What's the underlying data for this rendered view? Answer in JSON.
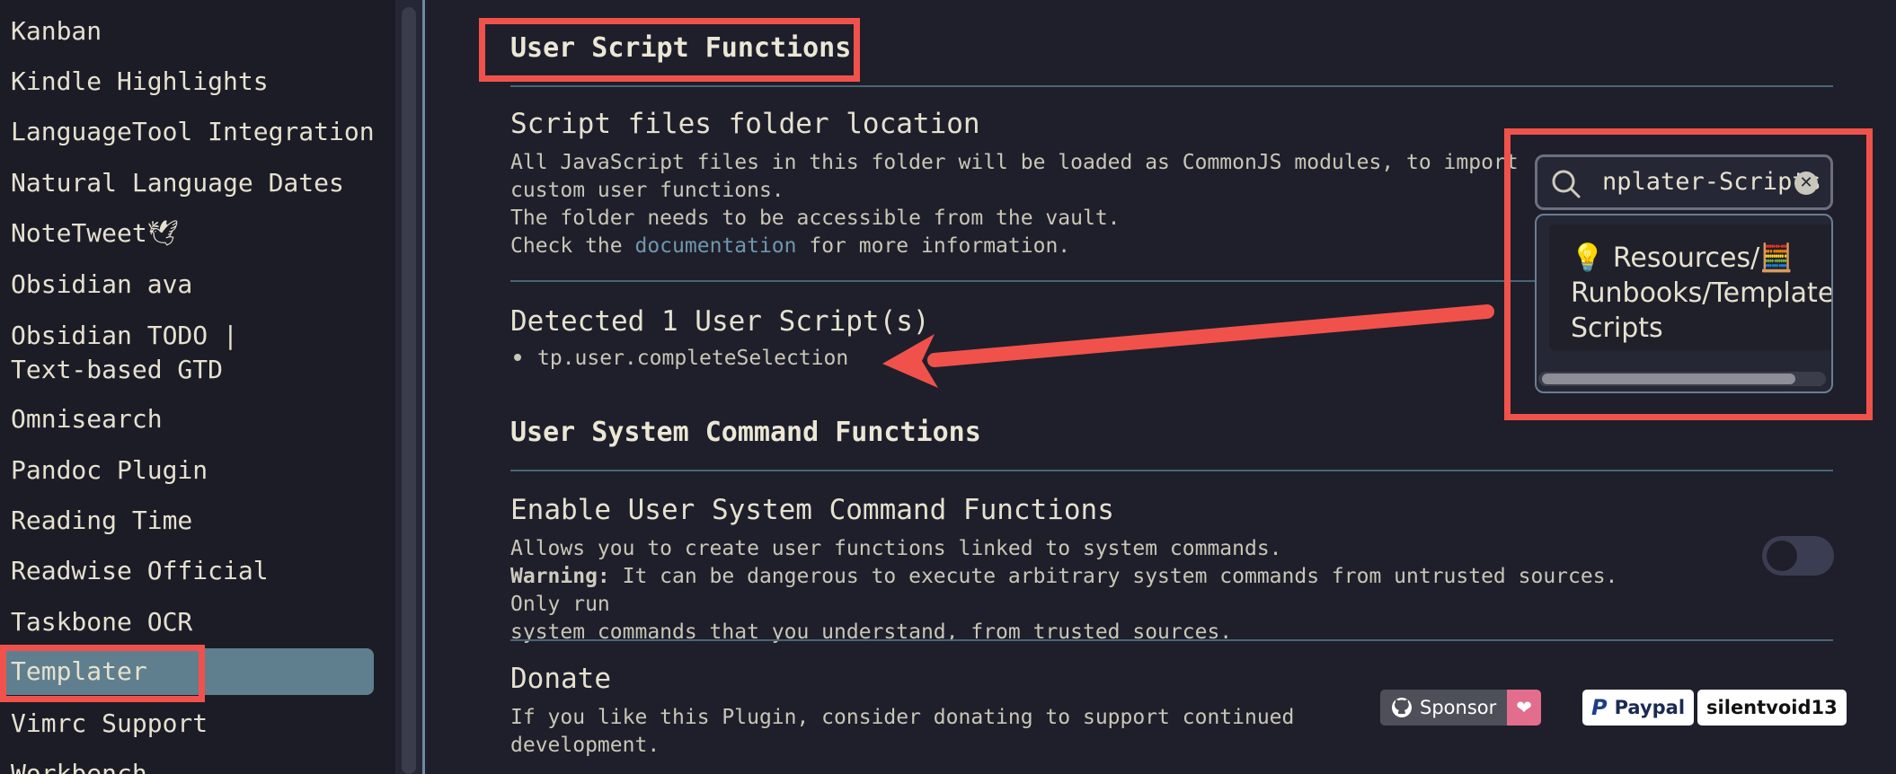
{
  "sidebar": {
    "items": [
      {
        "label": "Kanban"
      },
      {
        "label": "Kindle Highlights"
      },
      {
        "label": "LanguageTool Integration"
      },
      {
        "label": "Natural Language Dates"
      },
      {
        "label": "NoteTweet🕊"
      },
      {
        "label": "Obsidian ava"
      },
      {
        "label": "Obsidian TODO | Text-based GTD"
      },
      {
        "label": "Omnisearch"
      },
      {
        "label": "Pandoc Plugin"
      },
      {
        "label": "Reading Time"
      },
      {
        "label": "Readwise Official"
      },
      {
        "label": "Taskbone OCR"
      },
      {
        "label": "Templater"
      },
      {
        "label": "Vimrc Support"
      },
      {
        "label": "Workbench"
      }
    ],
    "active_item": "Templater"
  },
  "sections": {
    "user_script": {
      "heading": "User Script Functions",
      "folder_setting": {
        "name": "Script files folder location",
        "desc_line1": "All JavaScript files in this folder will be loaded as CommonJS modules, to import",
        "desc_line2": "custom user functions.",
        "desc_line3": "The folder needs to be accessible from the vault.",
        "desc_prefix": "Check the ",
        "desc_link": "documentation",
        "desc_suffix": " for more information."
      },
      "detected": {
        "title": "Detected 1 User Script(s)",
        "scripts": [
          "tp.user.completeSelection"
        ]
      }
    },
    "system_command": {
      "heading": "User System Command Functions",
      "enable_setting": {
        "name": "Enable User System Command Functions",
        "desc_line1": "Allows you to create user functions linked to system commands.",
        "warning_label": "Warning:",
        "desc_line2": " It can be dangerous to execute arbitrary system commands from untrusted sources. Only run",
        "desc_line3": "system commands that you understand, from trusted sources.",
        "enabled": false
      }
    },
    "donate": {
      "name": "Donate",
      "desc_line1": "If you like this Plugin, consider donating to support continued",
      "desc_line2": "development.",
      "sponsor_label": "Sponsor",
      "paypal_label": "Paypal",
      "paypal_user": "silentvoid13"
    }
  },
  "folder_search": {
    "value": "nplater-Scripts",
    "suggestion_line1": "💡 Resources/🧮",
    "suggestion_line2": "Runbooks/Template",
    "suggestion_line3": "Scripts"
  },
  "colors": {
    "background": "#1e1f2b",
    "sidebar": "#1b1c26",
    "active_item": "#5f7f8e",
    "annotation": "#f0524b",
    "link": "#6f97ad"
  }
}
